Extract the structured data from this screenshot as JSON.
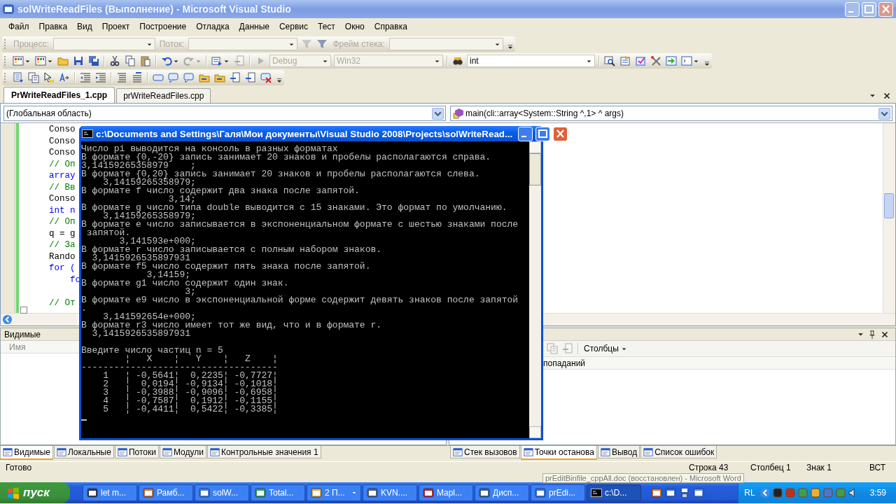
{
  "window": {
    "title": "solWriteReadFiles (Выполнение) - Microsoft Visual Studio"
  },
  "menu": [
    "Файл",
    "Правка",
    "Вид",
    "Проект",
    "Построение",
    "Отладка",
    "Данные",
    "Сервис",
    "Тест",
    "Окно",
    "Справка"
  ],
  "toolbars": [
    {
      "items": [
        {
          "kind": "label",
          "text": "Процесс:",
          "disabled": true
        },
        {
          "kind": "combo",
          "disabled": true
        },
        {
          "kind": "label",
          "text": "Поток:",
          "disabled": true
        },
        {
          "kind": "combo",
          "disabled": true
        },
        {
          "kind": "icon",
          "disabled": true
        },
        {
          "kind": "icon",
          "disabled": false
        },
        {
          "kind": "label",
          "text": "Фрейм стека:",
          "disabled": true
        },
        {
          "kind": "combo",
          "disabled": true
        }
      ]
    },
    {
      "items": [
        {
          "kind": "dropdown_icon",
          "disabled": false
        },
        {
          "kind": "dropdown_icon",
          "disabled": false
        },
        {
          "kind": "icon",
          "disabled": false
        },
        {
          "kind": "icon",
          "disabled": false
        },
        {
          "kind": "icon",
          "disabled": false
        },
        {
          "kind": "sep"
        },
        {
          "kind": "icon",
          "disabled": false
        },
        {
          "kind": "icon",
          "disabled": false
        },
        {
          "kind": "icon",
          "disabled": false
        },
        {
          "kind": "sep"
        },
        {
          "kind": "dropdown_icon",
          "disabled": false
        },
        {
          "kind": "dropdown_icon",
          "disabled": true
        },
        {
          "kind": "sep"
        },
        {
          "kind": "dropdown_icon",
          "disabled": false
        },
        {
          "kind": "icon",
          "disabled": true
        },
        {
          "kind": "sep"
        },
        {
          "kind": "icon",
          "disabled": true
        },
        {
          "kind": "combo",
          "value": "Debug",
          "disabled": true
        },
        {
          "kind": "combo",
          "value": "Win32",
          "disabled": true
        },
        {
          "kind": "sep"
        },
        {
          "kind": "icon",
          "disabled": false
        },
        {
          "kind": "field",
          "value": "int",
          "disabled": false
        },
        {
          "kind": "sep"
        },
        {
          "kind": "icon",
          "disabled": false
        },
        {
          "kind": "icon",
          "disabled": false
        },
        {
          "kind": "icon",
          "disabled": false
        },
        {
          "kind": "icon",
          "disabled": false
        },
        {
          "kind": "icon",
          "disabled": false
        },
        {
          "kind": "dropdown_icon",
          "disabled": false
        }
      ]
    },
    {
      "items": [
        {
          "kind": "icon",
          "disabled": false
        },
        {
          "kind": "icon",
          "disabled": false
        },
        {
          "kind": "icon",
          "disabled": false
        },
        {
          "kind": "icon",
          "disabled": false
        },
        {
          "kind": "sep"
        },
        {
          "kind": "icon",
          "disabled": false
        },
        {
          "kind": "icon",
          "disabled": false
        },
        {
          "kind": "sep"
        },
        {
          "kind": "icon",
          "disabled": false
        },
        {
          "kind": "icon",
          "disabled": false
        },
        {
          "kind": "sep"
        },
        {
          "kind": "icon",
          "disabled": false
        },
        {
          "kind": "icon",
          "disabled": false
        },
        {
          "kind": "icon",
          "disabled": false
        },
        {
          "kind": "icon",
          "disabled": false
        },
        {
          "kind": "icon",
          "disabled": false
        },
        {
          "kind": "icon",
          "disabled": false
        },
        {
          "kind": "icon",
          "disabled": false
        },
        {
          "kind": "icon",
          "disabled": false
        }
      ]
    }
  ],
  "doc_tabs": [
    {
      "label": "PrWriteReadFiles_1.cpp",
      "selected": true
    },
    {
      "label": "prWriteReadFiles.cpp",
      "selected": false
    }
  ],
  "navigation": {
    "scope": "(Глобальная область)",
    "member": "main(cli::array<System::String ^,1> ^ args)"
  },
  "code_blocks": [
    [
      {
        "text": "Conso",
        "kind": "plain"
      },
      {
        "text": "Conso",
        "kind": "plain"
      },
      {
        "text": "Conso",
        "kind": "plain"
      },
      {
        "text": "// Оп",
        "kind": "comment"
      },
      {
        "text": "array",
        "kind": "keyword"
      },
      {
        "text": "// Вв",
        "kind": "comment"
      },
      {
        "text": "Conso",
        "kind": "plain"
      },
      {
        "text": "int n",
        "kind": "keyword"
      },
      {
        "text": "// Оп",
        "kind": "comment"
      },
      {
        "text": "q = g",
        "kind": "plain"
      },
      {
        "text": "// За",
        "kind": "comment"
      },
      {
        "text": "Rando",
        "kind": "plain"
      },
      {
        "text": "for (",
        "kind": "keyword"
      },
      {
        "text": "    fo",
        "kind": "keyword"
      }
    ],
    [
      {
        "text": "// От",
        "kind": "comment"
      }
    ]
  ],
  "console": {
    "title": "c:\\Documents and Settings\\Галя\\Мои документы\\Visual Studio 2008\\Projects\\solWriteRead...",
    "groups": [
      [
        "Число pi выводится на консоль в разных форматах",
        "В формате {0,-20} запись занимает 20 знаков и пробелы располагаются справа.",
        "3,14159265358979    ;",
        "В формате {0,20} запись занимает 20 знаков и пробелы располагаются слева.",
        "    3,14159265358979;",
        "В формате f число содержит два знака после запятой.",
        "                3,14;",
        "В формате g число типа double выводится с 15 знаками. Это формат по умолчанию.",
        "    3,14159265358979;",
        "В формате e число записывается в экспоненциальном формате с шестью знаками после",
        " запятой.",
        "       3,141593e+000;",
        "В формате r число записывается с полным набором знаков.",
        "  3,1415926535897931",
        "В формате f5 число содержит пять знака после запятой.",
        "            3,14159;",
        "В формате g1 число содержит один знак.",
        "                   3;",
        "В формате e9 число в экспоненциальной форме содержит девять знаков после запятой",
        ".",
        "    3,141592654e+000;",
        "В формате r3 число имеет тот же вид, что и в формате r.",
        "  3,1415926535897931"
      ],
      [
        "Введите число частиц n = 5",
        "        ¦   X    ¦   Y    ¦   Z    ¦",
        "------------------------------------",
        "    1   ¦ -0,5641¦  0,2235¦ -0,7727¦",
        "    2   ¦  0,0194¦ -0,9134¦ -0,1018¦",
        "    3   ¦ -0,3988¦ -0,9096¦ -0,6958¦",
        "    4   ¦ -0,7587¦  0,1912¦ -0,1155¦",
        "    5   ¦ -0,4411¦  0,5422¦ -0,3385¦"
      ]
    ],
    "cursor": true
  },
  "watch_panel": {
    "title": "Видимые",
    "column": "Имя"
  },
  "breakpoints_panel": {
    "columns_button": "Столбцы",
    "column": "попаданий"
  },
  "bottom_tabs_left": [
    {
      "label": "Видимые",
      "selected": true
    },
    {
      "label": "Локальные",
      "selected": false
    },
    {
      "label": "Потоки",
      "selected": false
    },
    {
      "label": "Модули",
      "selected": false
    },
    {
      "label": "Контрольные значения 1",
      "selected": false
    }
  ],
  "bottom_tabs_right": [
    {
      "label": "Стек вызовов",
      "selected": false
    },
    {
      "label": "Точки останова",
      "selected": true
    },
    {
      "label": "Вывод",
      "selected": false
    },
    {
      "label": "Список ошибок",
      "selected": false
    }
  ],
  "status_bar": {
    "text": "Готово",
    "line": "Строка 43",
    "column": "Столбец 1",
    "char": "Знак 1",
    "mode": "ВСТ"
  },
  "tooltip": "prEditBinfile_cppAll.doc (восстановлен) - Microsoft Word",
  "taskbar": {
    "start": "пуск",
    "tasks": [
      {
        "label": "let m...",
        "selected": false,
        "kind": "task"
      },
      {
        "label": "Рамб...",
        "selected": false,
        "kind": "task"
      },
      {
        "label": "solW...",
        "selected": false,
        "kind": "task"
      },
      {
        "label": "Total...",
        "selected": false,
        "kind": "task"
      },
      {
        "label": "2 П...",
        "selected": false,
        "kind": "group"
      },
      {
        "label": "KVN....",
        "selected": false,
        "kind": "task"
      },
      {
        "label": "Mapl...",
        "selected": false,
        "kind": "task"
      },
      {
        "label": "Дисп...",
        "selected": false,
        "kind": "task"
      },
      {
        "label": "prEdi...",
        "selected": false,
        "kind": "task"
      },
      {
        "label": "c:\\D...",
        "selected": true,
        "kind": "task"
      }
    ],
    "language": "RL",
    "clock": "3:59"
  }
}
